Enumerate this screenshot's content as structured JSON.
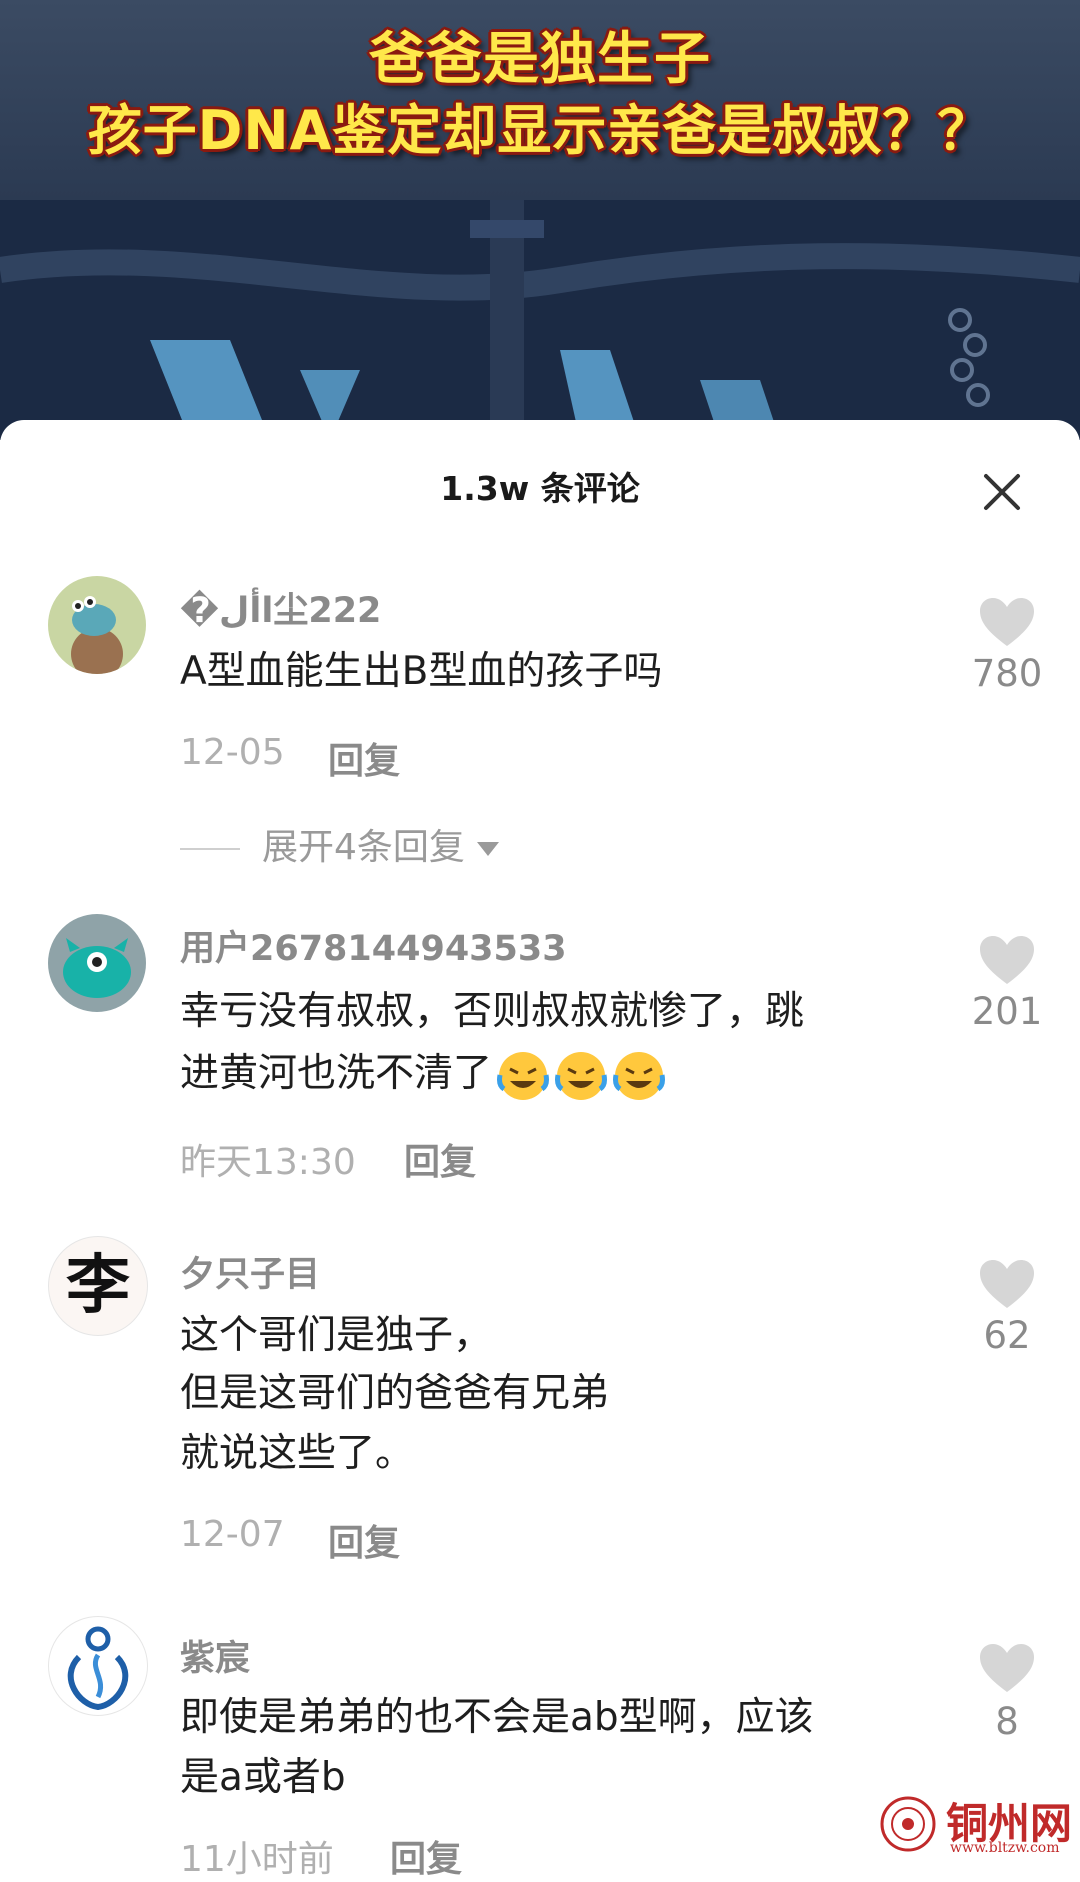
{
  "video": {
    "headline_line1": "爸爸是独生子",
    "headline_line2": "孩子DNA鉴定却显示亲爸是叔叔？？"
  },
  "sheet": {
    "title": "1.3w 条评论",
    "close_icon": "close-icon"
  },
  "comments": [
    {
      "username": "�األ尘222",
      "text_lines": [
        "A型血能生出B型血的孩子吗"
      ],
      "date": "12-05",
      "reply_label": "回复",
      "likes": "780",
      "expand_label": "展开4条回复"
    },
    {
      "username": "用户2678144943533",
      "text_lines": [
        "幸亏没有叔叔，否则叔叔就惨了，跳",
        "进黄河也洗不清了"
      ],
      "emojis": [
        "laughing-crying-emoji",
        "laughing-crying-emoji",
        "laughing-crying-emoji"
      ],
      "date": "昨天13:30",
      "reply_label": "回复",
      "likes": "201"
    },
    {
      "username": "夕只子目",
      "avatar_char": "李",
      "text_lines": [
        "这个哥们是独子，",
        "但是这哥们的爸爸有兄弟",
        "就说这些了。"
      ],
      "date": "12-07",
      "reply_label": "回复",
      "likes": "62"
    },
    {
      "username": "紫宸",
      "text_lines": [
        "即使是弟弟的也不会是ab型啊，应该",
        "是a或者b"
      ],
      "date": "11小时前",
      "reply_label": "回复",
      "likes": "8"
    }
  ],
  "watermark": {
    "text": "铜州网",
    "url": "www.bltzw.com"
  }
}
